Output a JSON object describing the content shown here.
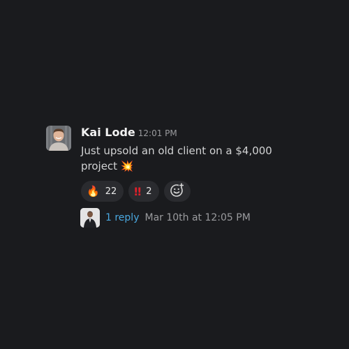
{
  "message": {
    "author": "Kai Lode",
    "time": "12:01 PM",
    "text_line1": "Just upsold an old client on a $4,000",
    "text_line2": "project",
    "text_emoji": "💥",
    "avatar": "author-avatar-photo"
  },
  "reactions": [
    {
      "emoji": "🔥",
      "icon": "fire-emoji",
      "count": "22"
    },
    {
      "emoji": "‼",
      "icon": "double-exclamation-emoji",
      "count": "2"
    }
  ],
  "add_reaction_icon": "add-emoji-reaction-icon",
  "thread": {
    "reply_label": "1 reply",
    "last_reply_time": "Mar 10th at 12:05 PM",
    "replier_avatar": "replier-avatar-photo"
  },
  "colors": {
    "background": "#1a1b1e",
    "link": "#4aa8e0",
    "reaction_pill": "#2a2b2f",
    "exclamation_red": "#e0202a"
  }
}
